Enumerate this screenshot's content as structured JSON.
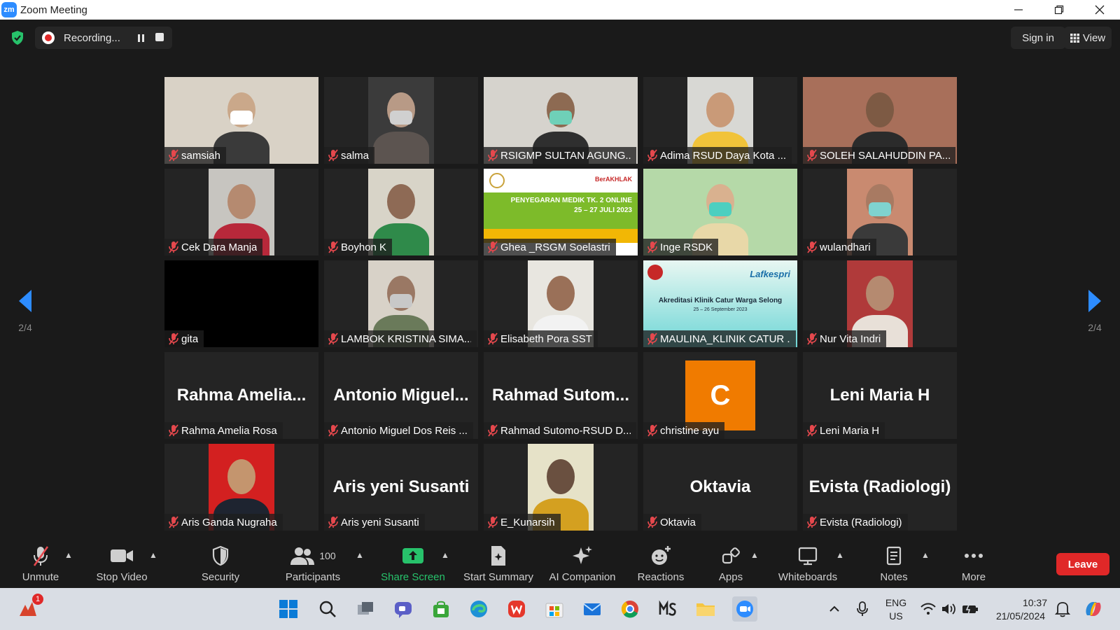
{
  "window": {
    "title": "Zoom Meeting",
    "app_icon": "zm"
  },
  "topbar": {
    "recording_label": "Recording...",
    "sign_in": "Sign in",
    "view": "View"
  },
  "pagination": {
    "left": "2/4",
    "right": "2/4"
  },
  "tiles": [
    {
      "name": "samsiah",
      "kind": "video"
    },
    {
      "name": "salma",
      "kind": "video"
    },
    {
      "name": "RSIGMP SULTAN AGUNG...",
      "kind": "video"
    },
    {
      "name": "Adima RSUD Daya Kota ...",
      "kind": "video"
    },
    {
      "name": "SOLEH SALAHUDDIN PA...",
      "kind": "video"
    },
    {
      "name": "Cek Dara Manja",
      "kind": "video"
    },
    {
      "name": "Boyhon K",
      "kind": "video"
    },
    {
      "name": "Ghea _RSGM Soelastri",
      "kind": "banner",
      "banner_title": "PENYEGARAN MEDIK TK. 2 ONLINE",
      "banner_date": "25 – 27 JULI 2023",
      "banner_tag": "BerAKHLAK"
    },
    {
      "name": "Inge RSDK",
      "kind": "video"
    },
    {
      "name": "wulandhari",
      "kind": "video"
    },
    {
      "name": "gita",
      "kind": "black"
    },
    {
      "name": "LAMBOK KRISTINA SIMA...",
      "kind": "video"
    },
    {
      "name": "Elisabeth Pora SST",
      "kind": "video"
    },
    {
      "name": "MAULINA_KLINIK CATUR ...",
      "kind": "banner2",
      "banner_title": "Akreditasi Klinik Catur Warga Selong",
      "banner_date": "25 – 26 September 2023",
      "banner_logo": "Lafkespri"
    },
    {
      "name": "Nur Vita Indri",
      "kind": "video"
    },
    {
      "name": "Rahma Amelia Rosa",
      "kind": "name",
      "display": "Rahma Amelia..."
    },
    {
      "name": "Antonio Miguel Dos Reis ...",
      "kind": "name",
      "display": "Antonio Miguel..."
    },
    {
      "name": "Rahmad Sutomo-RSUD D...",
      "kind": "name",
      "display": "Rahmad Sutom..."
    },
    {
      "name": "christine ayu",
      "kind": "avatar",
      "display": "C"
    },
    {
      "name": "Leni Maria H",
      "kind": "name",
      "display": "Leni Maria H"
    },
    {
      "name": "Aris Ganda Nugraha",
      "kind": "video"
    },
    {
      "name": "Aris yeni Susanti",
      "kind": "name",
      "display": "Aris yeni Susanti"
    },
    {
      "name": "E_Kunarsih",
      "kind": "video"
    },
    {
      "name": "Oktavia",
      "kind": "name",
      "display": "Oktavia"
    },
    {
      "name": "Evista (Radiologi)",
      "kind": "name",
      "display": "Evista (Radiologi)"
    }
  ],
  "toolbar": {
    "unmute": "Unmute",
    "stop_video": "Stop Video",
    "security": "Security",
    "participants": "Participants",
    "participants_count": "100",
    "share_screen": "Share Screen",
    "start_summary": "Start Summary",
    "ai_companion": "AI Companion",
    "reactions": "Reactions",
    "apps": "Apps",
    "whiteboards": "Whiteboards",
    "notes": "Notes",
    "more": "More",
    "leave": "Leave"
  },
  "taskbar": {
    "notification_badge": "1",
    "lang_line1": "ENG",
    "lang_line2": "US",
    "time": "10:37",
    "date": "21/05/2024"
  },
  "colors": {
    "accent_blue": "#2D8CFF",
    "leave_red": "#E02828",
    "share_green": "#27C26B",
    "avatar_orange": "#F07B00",
    "mute_red": "#E5484D"
  }
}
